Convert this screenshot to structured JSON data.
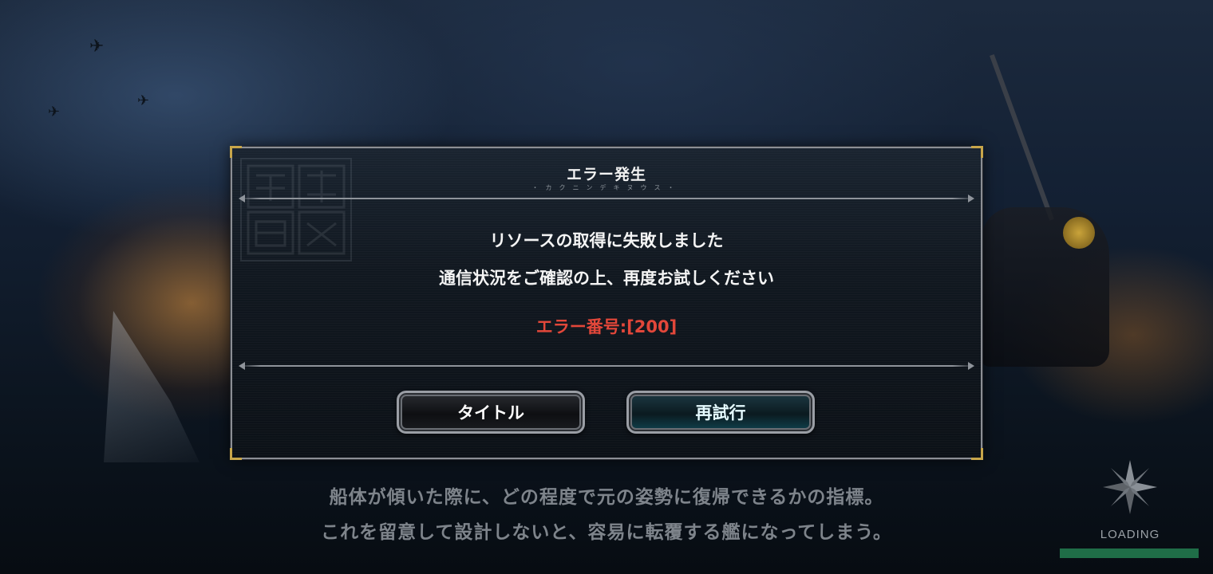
{
  "dialog": {
    "title": "エラー発生",
    "subtitle": "・カクニンデキヌウス・",
    "message_line1": "リソースの取得に失敗しました",
    "message_line2": "通信状況をご確認の上、再度お試しください",
    "error_code": "エラー番号:[200]",
    "title_button_label": "タイトル",
    "retry_button_label": "再試行"
  },
  "tip": {
    "line1": "船体が傾いた際に、どの程度で元の姿勢に復帰できるかの指標。",
    "line2": "これを留意して設計しないと、容易に転覆する艦になってしまう。"
  },
  "loading": {
    "label": "LOADING",
    "progress_fraction": 1.0
  },
  "colors": {
    "error_red": "#e2473a",
    "loading_green": "#1f6d47",
    "frame_gold": "#c8a64a"
  },
  "icons": [
    "compass-icon",
    "plane-silhouette",
    "ship-emblem"
  ]
}
